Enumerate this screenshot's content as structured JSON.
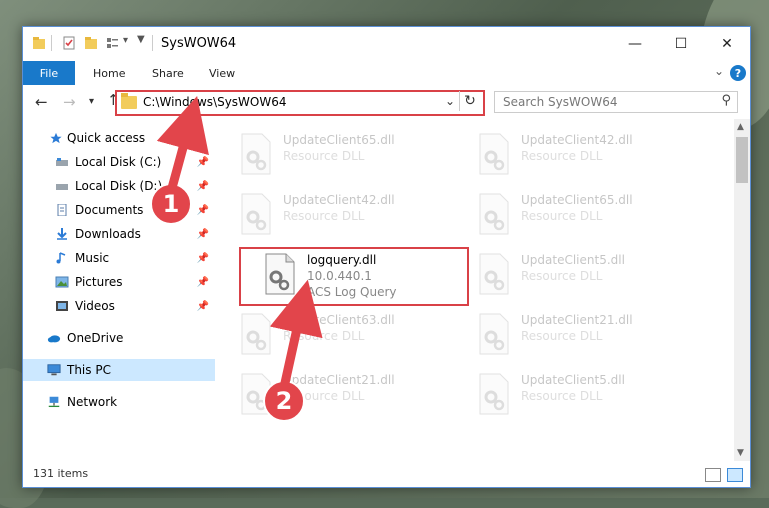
{
  "window": {
    "title": "SysWOW64",
    "controls": {
      "minimize": "—",
      "maximize": "☐",
      "close": "✕"
    }
  },
  "ribbon": {
    "file": "File",
    "tabs": [
      "Home",
      "Share",
      "View"
    ],
    "help": "?"
  },
  "navbar": {
    "address": "C:\\Windows\\SysWOW64",
    "search_placeholder": "Search SysWOW64"
  },
  "sidebar": {
    "items": [
      {
        "label": "Quick access",
        "icon": "star-icon"
      },
      {
        "label": "Local Disk (C:)",
        "icon": "drive-icon"
      },
      {
        "label": "Local Disk (D:)",
        "icon": "drive-icon"
      },
      {
        "label": "Documents",
        "icon": "documents-icon"
      },
      {
        "label": "Downloads",
        "icon": "download-icon"
      },
      {
        "label": "Music",
        "icon": "music-icon"
      },
      {
        "label": "Pictures",
        "icon": "pictures-icon"
      },
      {
        "label": "Videos",
        "icon": "videos-icon"
      },
      {
        "label": "OneDrive",
        "icon": "cloud-icon"
      },
      {
        "label": "This PC",
        "icon": "computer-icon"
      },
      {
        "label": "Network",
        "icon": "network-icon"
      }
    ],
    "selected": "This PC"
  },
  "files": {
    "faded_type": "Resource DLL",
    "left": [
      "UpdateClient65.dll",
      "UpdateClient42.dll",
      "UpdateClient63.dll",
      "UpdateClient21.dll"
    ],
    "right": [
      "UpdateClient42.dll",
      "UpdateClient65.dll",
      "UpdateClient5.dll",
      "UpdateClient21.dll",
      "UpdateClient5.dll"
    ],
    "highlighted": {
      "name": "logquery.dll",
      "version": "10.0.440.1",
      "description": "ACS Log Query"
    }
  },
  "status": {
    "item_count": "131 items"
  },
  "annotations": {
    "step1": "1",
    "step2": "2"
  },
  "colors": {
    "accent": "#1979ca",
    "highlight": "#d94147",
    "selection": "#cce8ff"
  }
}
